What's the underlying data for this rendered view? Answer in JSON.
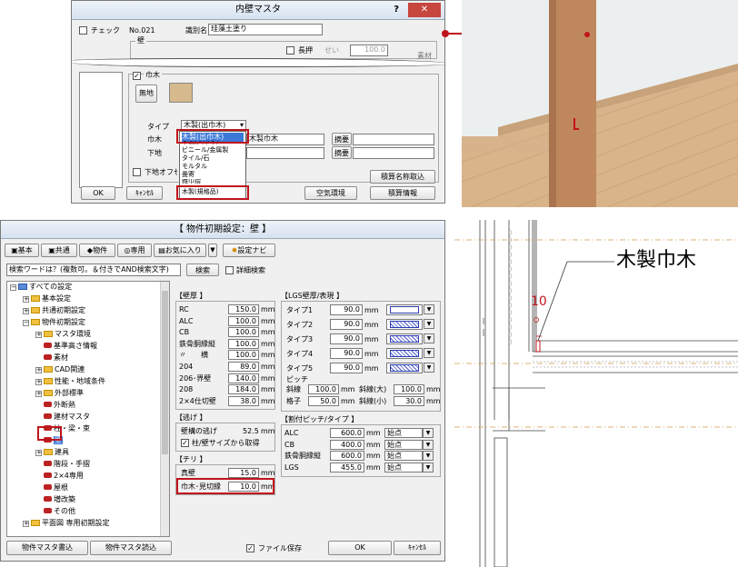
{
  "dialog1": {
    "title": "内壁マスタ",
    "help": "?",
    "close": "✕",
    "check_label": "チェック",
    "no": "No.021",
    "id_label": "識別名",
    "id_value": "珪藻土塗り",
    "wall_group": "壁",
    "nagaoshi_label": "長押",
    "sei_label": "せい",
    "sei_value": "100.0",
    "sozai_label": "素材",
    "habaki_label": "巾木",
    "mushi_label": "無地",
    "type_label": "タイプ",
    "type_value": "木製(出巾木)",
    "habaki_field_label": "巾木",
    "habaki_value": "木製巾木",
    "shitaji_label": "下地",
    "tekiyo1": "摘要",
    "tekiyo2": "摘要",
    "shitaji_offset": "下地オフセット",
    "options": [
      "木製(出巾木)",
      "木製(入巾木)",
      "ビニール/金属製",
      "タイル/石",
      "モルタル",
      "畳寄",
      "雑巾摺",
      "木製(規格品)"
    ],
    "btn_sekisan_meisho": "積算名称取込",
    "btn_kuki": "空気環境",
    "btn_sekisan_joho": "積算情報",
    "btn_ok": "OK",
    "btn_cancel": "ｷｬﾝｾﾙ"
  },
  "annot1": {
    "label": "木製巾木",
    "dim": "10"
  },
  "dialog2": {
    "title": "【 物件初期設定：壁 】",
    "tabs": [
      "基本",
      "共通",
      "物件",
      "専用",
      "お気に入り",
      "▼",
      "設定ナビ"
    ],
    "search_placeholder": "検索ワードは？(複数可。＆付きでAND検索文字)",
    "search_btn": "検索",
    "detail_search": "詳細検索",
    "tree": [
      {
        "label": "すべての設定",
        "kind": "root",
        "pm": "−"
      },
      {
        "label": "基本設定",
        "kind": "folder",
        "pm": "+"
      },
      {
        "label": "共通初期設定",
        "kind": "folder",
        "pm": "+"
      },
      {
        "label": "物件初期設定",
        "kind": "folder",
        "pm": "−"
      },
      {
        "label": "マスタ環境",
        "kind": "folder",
        "pm": "+"
      },
      {
        "label": "基準高さ情報",
        "kind": "book",
        "pm": ""
      },
      {
        "label": "素材",
        "kind": "book",
        "pm": ""
      },
      {
        "label": "CAD関連",
        "kind": "folder",
        "pm": "+"
      },
      {
        "label": "性能・地域条件",
        "kind": "folder",
        "pm": "+"
      },
      {
        "label": "外部標準",
        "kind": "folder",
        "pm": "+"
      },
      {
        "label": "外断熱",
        "kind": "book",
        "pm": ""
      },
      {
        "label": "建材マスタ",
        "kind": "book",
        "pm": ""
      },
      {
        "label": "柱・梁・束",
        "kind": "book",
        "pm": ""
      },
      {
        "label": "壁",
        "kind": "book",
        "pm": "",
        "selected": true
      },
      {
        "label": "建具",
        "kind": "folder",
        "pm": "+"
      },
      {
        "label": "階段・手摺",
        "kind": "book",
        "pm": ""
      },
      {
        "label": "2×4専用",
        "kind": "book",
        "pm": ""
      },
      {
        "label": "屋根",
        "kind": "book",
        "pm": ""
      },
      {
        "label": "増改築",
        "kind": "book",
        "pm": ""
      },
      {
        "label": "その他",
        "kind": "book",
        "pm": ""
      },
      {
        "label": "平面図 専用初期設定",
        "kind": "folder",
        "pm": "+"
      }
    ],
    "wall_thickness_title": "【壁厚 】",
    "wall_thickness": [
      {
        "label": "RC",
        "value": "150.0"
      },
      {
        "label": "ALC",
        "value": "100.0"
      },
      {
        "label": "CB",
        "value": "100.0"
      },
      {
        "label": "鉄骨胴縁縦",
        "value": "100.0"
      },
      {
        "label": "〃　　横",
        "value": "100.0"
      },
      {
        "label": "204",
        "value": "89.0"
      },
      {
        "label": "206･界壁",
        "value": "140.0"
      },
      {
        "label": "208",
        "value": "184.0"
      },
      {
        "label": "2×4仕切壁",
        "value": "38.0"
      }
    ],
    "unit": "mm",
    "nige_title": "【逃げ 】",
    "nige_label": "壁構の逃げ",
    "nige_value": "52.5",
    "nige_check": "柱/壁サイズから取得",
    "chiri_title": "【チリ 】",
    "chiri": [
      {
        "label": "真壁",
        "value": "15.0"
      },
      {
        "label": "巾木･見切縁",
        "value": "10.0"
      }
    ],
    "lgs_title": "【LGS壁厚/表現 】",
    "lgs": [
      {
        "label": "タイプ1",
        "value": "90.0"
      },
      {
        "label": "タイプ2",
        "value": "90.0"
      },
      {
        "label": "タイプ3",
        "value": "90.0"
      },
      {
        "label": "タイプ4",
        "value": "90.0"
      },
      {
        "label": "タイプ5",
        "value": "90.0"
      }
    ],
    "pitch_title": "ピッチ",
    "pitch": [
      {
        "label": "斜線",
        "value": "100.0",
        "label2": "斜線(大)",
        "value2": "100.0"
      },
      {
        "label": "格子",
        "value": "50.0",
        "label2": "斜線(小)",
        "value2": "30.0"
      }
    ],
    "wari_title": "【割付ピッチ/タイプ 】",
    "wari": [
      {
        "label": "ALC",
        "value": "600.0",
        "type": "始点"
      },
      {
        "label": "CB",
        "value": "400.0",
        "type": "始点"
      },
      {
        "label": "鉄骨胴縁縦",
        "value": "600.0",
        "type": "始点"
      },
      {
        "label": "LGS",
        "value": "455.0",
        "type": "始点"
      }
    ],
    "btn_master_write": "物件マスタ書込",
    "btn_master_read": "物件マスタ読込",
    "file_save": "ファイル保存",
    "btn_ok": "OK",
    "btn_cancel": "ｷｬﾝｾﾙ"
  }
}
